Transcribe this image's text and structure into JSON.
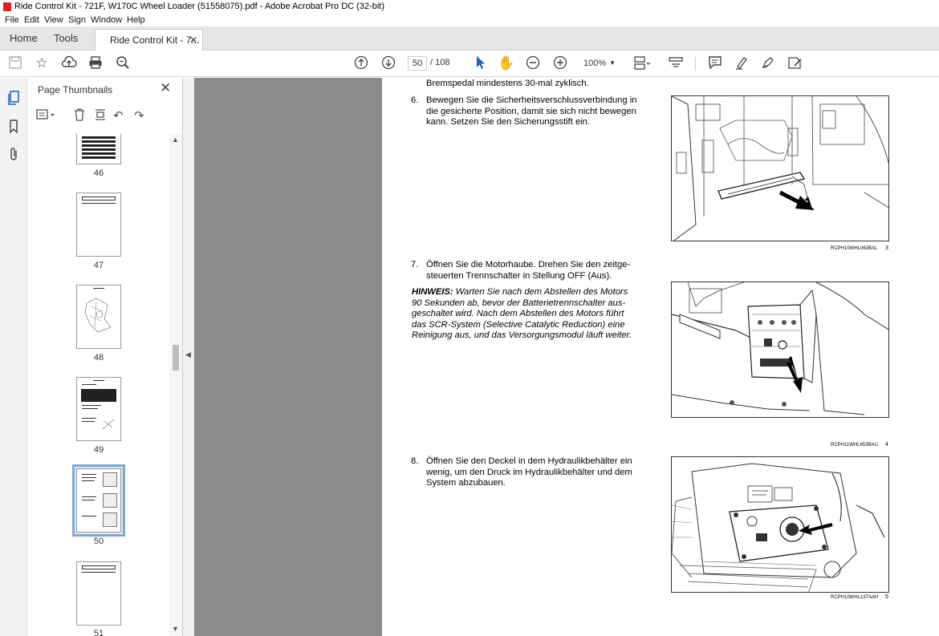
{
  "window": {
    "title": "Ride Control Kit - 721F, W170C Wheel Loader (51558075).pdf - Adobe Acrobat Pro DC (32-bit)"
  },
  "menu": [
    "File",
    "Edit",
    "View",
    "Sign",
    "Window",
    "Help"
  ],
  "tabs": {
    "home": "Home",
    "tools": "Tools",
    "document": "Ride Control Kit - 7...",
    "close": "✕"
  },
  "toolbar": {
    "page_current": "50",
    "page_total": "/ 108",
    "zoom": "100%"
  },
  "thumbnails_panel": {
    "title": "Page Thumbnails",
    "close": "✕",
    "pages": [
      "46",
      "47",
      "48",
      "49",
      "50",
      "51"
    ],
    "selected_page": "50"
  },
  "document": {
    "top_line": "Bremspedal mindestens 30-mal zyklisch.",
    "steps": [
      {
        "number": "6.",
        "lines": [
          "Bewegen Sie die Sicherheitsverschlussverbindung in",
          "die gesicherte Position, damit sie sich nicht bewegen",
          "kann.  Setzen Sie den Sicherungsstift ein."
        ],
        "figure_caption": "RCPH10WHL063BAL",
        "figure_number": "3"
      },
      {
        "number": "7.",
        "lines": [
          "Öffnen Sie die Motorhaube.  Drehen Sie den zeitge-",
          "steuerten Trennschalter in Stellung OFF (Aus)."
        ],
        "figure_caption": "RCPH11WHL653BAU",
        "figure_number": "4"
      },
      {
        "number": "8.",
        "lines": [
          "Öffnen Sie den Deckel in dem Hydraulikbehälter ein",
          "wenig, um den Druck im Hydraulikbehälter und dem",
          "System abzubauen."
        ],
        "figure_caption": "RCPH10WHL137AAH",
        "figure_number": "5"
      }
    ],
    "note": {
      "label": "HINWEIS:",
      "lines": [
        "Warten Sie nach dem Abstellen des Motors",
        "90 Sekunden ab, bevor der Batterietrennschalter aus-",
        "geschaltet wird.  Nach dem Abstellen des Motors führt",
        "das SCR-System (Selective Catalytic Reduction) eine",
        "Reinigung aus, und das Versorgungsmodul läuft weiter."
      ]
    }
  },
  "icons": {
    "save": "save-icon",
    "bookmark": "star-icon",
    "upload": "cloud-upload-icon",
    "print": "print-icon",
    "search": "zoom-search-icon"
  }
}
